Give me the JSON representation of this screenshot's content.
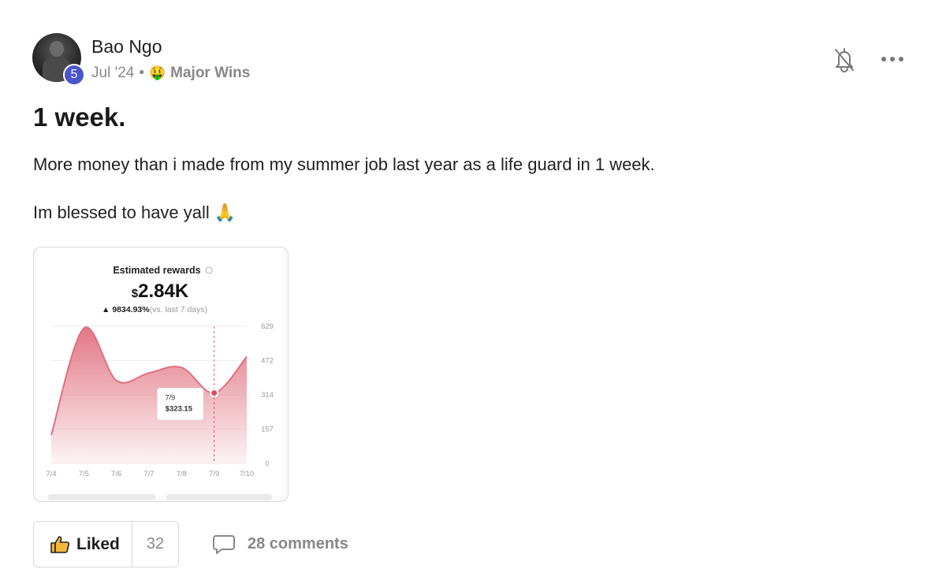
{
  "post": {
    "author": "Bao Ngo",
    "level": "5",
    "date": "Jul '24",
    "separator": "•",
    "category_emoji": "🤑",
    "category": "Major Wins",
    "title": "1 week.",
    "body": [
      "More money than i made from my summer job last year as a life guard in 1 week.",
      "Im blessed to have yall 🙏"
    ]
  },
  "actions": {
    "like_label": "Liked",
    "like_count": "32",
    "comments_label": "28 comments"
  },
  "icons": {
    "bell": "bell-off-icon",
    "more": "more-horizontal-icon",
    "like": "thumbs-up-icon",
    "comment": "comment-bubble-icon"
  },
  "attachment": {
    "chart_data": {
      "type": "area",
      "title": "Estimated rewards",
      "total": "2.84K",
      "currency": "$",
      "change": "9834.93%",
      "change_note": "(vs. last 7 days)",
      "categories": [
        "7/4",
        "7/5",
        "7/6",
        "7/7",
        "7/8",
        "7/9",
        "7/10"
      ],
      "values": [
        130,
        620,
        380,
        415,
        440,
        323.15,
        490
      ],
      "yticks": [
        "629",
        "472",
        "314",
        "157",
        "0"
      ],
      "ylim": [
        0,
        629
      ],
      "tooltip": {
        "date": "7/9",
        "value": "$323.15"
      },
      "highlight_index": 5,
      "color": "#e0707f",
      "grid": true
    }
  }
}
